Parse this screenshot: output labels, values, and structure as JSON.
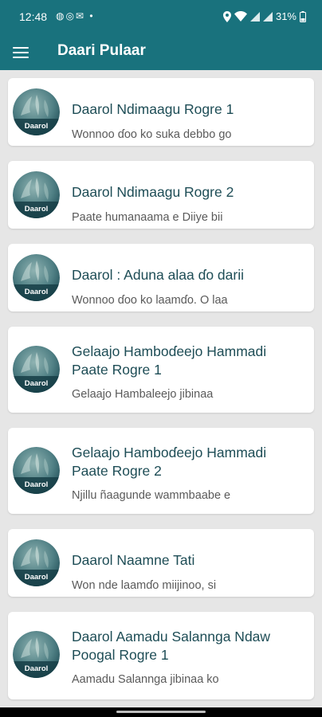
{
  "status_bar": {
    "time": "12:48",
    "notification_icons": [
      "messenger-icon",
      "whatsapp-icon",
      "gmail-icon"
    ],
    "dot": "•",
    "battery": "31%",
    "status_icons": [
      "location-icon",
      "wifi-icon",
      "signal-icon",
      "signal-icon",
      "battery-icon"
    ]
  },
  "app_bar": {
    "title": "Daari Pulaar",
    "menu_icon": "hamburger-menu-icon"
  },
  "thumb_label": "Daarol",
  "items": [
    {
      "title": "Daarol Ndimaagu Rogre 1",
      "subtitle": "Wonnoo ɗoo ko suka debbo go"
    },
    {
      "title": "Daarol Ndimaagu Rogre 2",
      "subtitle": "Paate humanaama e Diiye bii"
    },
    {
      "title": "Daarol : Aduna alaa ɗo darii",
      "subtitle": "Wonnoo ɗoo ko laamɗo. O laa"
    },
    {
      "title": "Gelaajo Hamboɗeejo Hammadi Paate Rogre 1",
      "subtitle": "Gelaajo Hambaleejo jibinaa"
    },
    {
      "title": "Gelaajo Hamboɗeejo Hammadi Paate Rogre 2",
      "subtitle": "Njillu ñaagunde wammbaabe e"
    },
    {
      "title": "Daarol Naamne Tati",
      "subtitle": "Won nde laamɗo miijinoo, si"
    },
    {
      "title": "Daarol Aamadu Salannga Ndaw Poogal Rogre 1",
      "subtitle": "Aamadu Salannga jibinaa ko"
    }
  ],
  "colors": {
    "primary": "#19727d",
    "background": "#e6e6e6",
    "card": "#ffffff",
    "title_text": "#1e4d56",
    "subtitle_text": "#5a5a5a"
  }
}
